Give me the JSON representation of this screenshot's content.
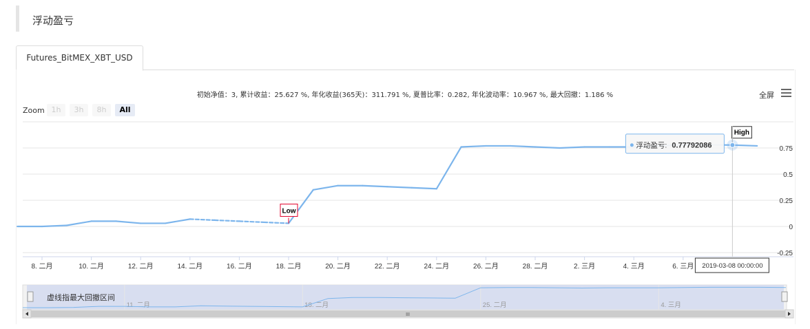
{
  "section": {
    "title": "浮动盈亏"
  },
  "tabs": [
    {
      "label": "Futures_BitMEX_XBT_USD"
    }
  ],
  "stats_line": "初始净值：3, 累计收益：25.627 %, 年化收益(365天)：311.791 %, 夏普比率：0.282, 年化波动率：10.967 %, 最大回撤：1.186 %",
  "toolbar": {
    "fullscreen_label": "全屏",
    "menu_icon": "hamburger-menu-icon"
  },
  "zoom": {
    "label": "Zoom",
    "buttons": [
      "1h",
      "3h",
      "8h",
      "All"
    ],
    "selected": "All"
  },
  "navigator": {
    "label": "虚线指最大回撤区间",
    "tick_labels": [
      "11. 二月",
      "18. 二月",
      "25. 二月",
      "4. 三月"
    ],
    "scroll_grip": "III"
  },
  "tooltip": {
    "series_name": "浮动盈亏",
    "value": "0.77792086"
  },
  "crosshair_label": "2019-03-08 00:00:00",
  "flags": {
    "low": "Low",
    "high": "High"
  },
  "colors": {
    "line": "#7cb5ec",
    "low_flag": "#e0002b",
    "navigator_fill": "#d5dcf0"
  },
  "chart_data": {
    "type": "line",
    "x_tick_labels": [
      "8. 二月",
      "10. 二月",
      "12. 二月",
      "14. 二月",
      "16. 二月",
      "18. 二月",
      "20. 二月",
      "22. 二月",
      "24. 二月",
      "26. 二月",
      "28. 二月",
      "2. 三月",
      "4. 三月",
      "6. 三月"
    ],
    "y_tick_labels": [
      "-0.25",
      "0",
      "0.25",
      "0.5",
      "0.75"
    ],
    "ylim": [
      -0.25,
      1.0
    ],
    "series": [
      {
        "name": "浮动盈亏",
        "x": [
          "2019-02-07",
          "2019-02-08",
          "2019-02-09",
          "2019-02-10",
          "2019-02-11",
          "2019-02-12",
          "2019-02-13",
          "2019-02-14",
          "2019-02-15",
          "2019-02-16",
          "2019-02-17",
          "2019-02-18",
          "2019-02-19",
          "2019-02-20",
          "2019-02-21",
          "2019-02-22",
          "2019-02-23",
          "2019-02-24",
          "2019-02-25",
          "2019-02-26",
          "2019-02-27",
          "2019-02-28",
          "2019-03-01",
          "2019-03-02",
          "2019-03-03",
          "2019-03-04",
          "2019-03-05",
          "2019-03-06",
          "2019-03-07",
          "2019-03-08",
          "2019-03-09"
        ],
        "y": [
          0,
          0,
          0.01,
          0.05,
          0.05,
          0.03,
          0.03,
          0.07,
          0.06,
          0.05,
          0.04,
          0.03,
          0.35,
          0.39,
          0.39,
          0.38,
          0.37,
          0.36,
          0.76,
          0.77,
          0.77,
          0.76,
          0.75,
          0.76,
          0.76,
          0.76,
          0.77,
          0.78,
          0.78,
          0.778,
          0.77
        ],
        "dashed_range": [
          "2019-02-14",
          "2019-02-18"
        ]
      }
    ],
    "low_point": {
      "x": "2019-02-18",
      "y": 0.03
    },
    "high_point": {
      "x": "2019-03-08",
      "y": 0.778
    },
    "grid": true,
    "legend": "none"
  }
}
